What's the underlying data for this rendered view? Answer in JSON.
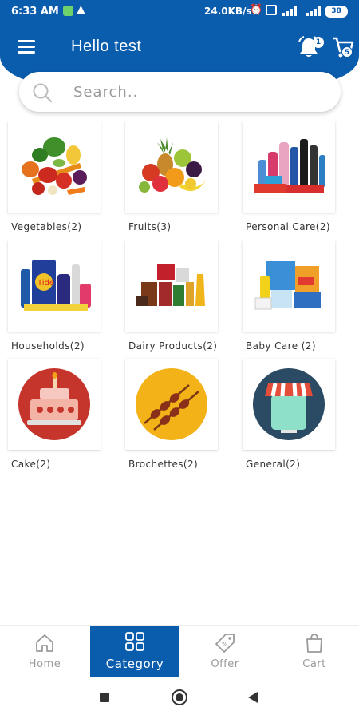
{
  "status_bar": {
    "time": "6:33 AM",
    "speed": "24.0KB/s",
    "battery": "38"
  },
  "header": {
    "greeting": "Hello test",
    "notification_count": "1",
    "cart_count": "5"
  },
  "search": {
    "placeholder": "Search.."
  },
  "categories": [
    {
      "label": "Vegetables(2)",
      "icon": "vegetables-image"
    },
    {
      "label": "Fruits(3)",
      "icon": "fruits-image"
    },
    {
      "label": "Personal Care(2)",
      "icon": "personal-care-image"
    },
    {
      "label": "Households(2)",
      "icon": "households-image"
    },
    {
      "label": "Dairy Products(2)",
      "icon": "dairy-products-image"
    },
    {
      "label": "Baby Care (2)",
      "icon": "baby-care-image"
    },
    {
      "label": "Cake(2)",
      "icon": "cake-icon"
    },
    {
      "label": "Brochettes(2)",
      "icon": "brochettes-icon"
    },
    {
      "label": "General(2)",
      "icon": "general-store-icon"
    }
  ],
  "bottom_nav": {
    "home": "Home",
    "category": "Category",
    "offer": "Offer",
    "cart": "Cart"
  },
  "colors": {
    "primary": "#0a5cad",
    "inactive": "#9a9a9a"
  }
}
